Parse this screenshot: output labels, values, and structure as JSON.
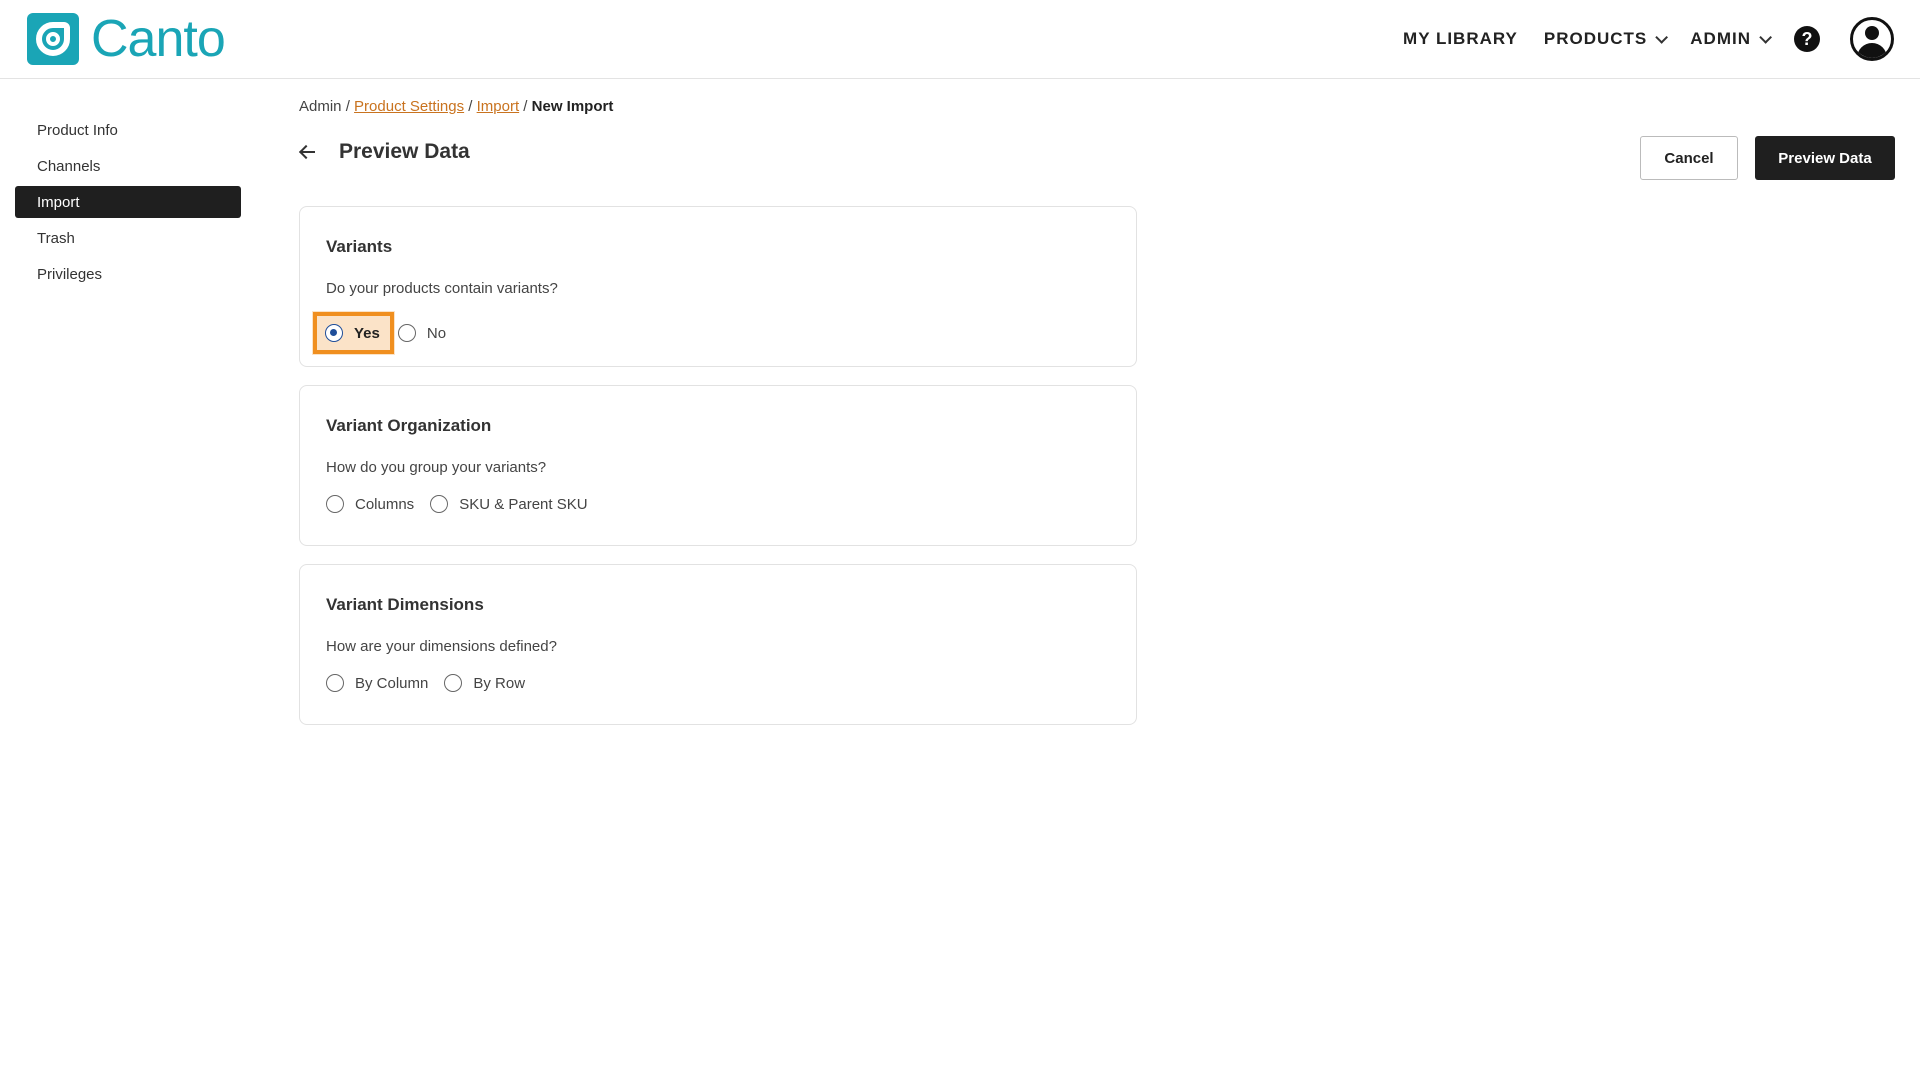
{
  "brand": {
    "name": "Canto",
    "color": "#1aa5b6"
  },
  "topnav": {
    "items": [
      {
        "label": "MY LIBRARY",
        "dropdown": false
      },
      {
        "label": "PRODUCTS",
        "dropdown": true
      },
      {
        "label": "ADMIN",
        "dropdown": true
      }
    ],
    "help_icon": "question-circle-icon",
    "help_glyph": "?",
    "avatar_icon": "user-avatar-icon"
  },
  "sidebar": {
    "items": [
      {
        "label": "Product Info",
        "active": false
      },
      {
        "label": "Channels",
        "active": false
      },
      {
        "label": "Import",
        "active": true
      },
      {
        "label": "Trash",
        "active": false
      },
      {
        "label": "Privileges",
        "active": false
      }
    ]
  },
  "breadcrumb": {
    "root": "Admin",
    "separator": " / ",
    "links": [
      "Product Settings",
      "Import"
    ],
    "current": "New Import"
  },
  "page": {
    "title": "Preview Data",
    "back_icon": "arrow-left-icon",
    "cancel_label": "Cancel",
    "preview_label": "Preview Data"
  },
  "cards": [
    {
      "title": "Variants",
      "question": "Do your products contain variants?",
      "options": [
        {
          "label": "Yes",
          "selected": true
        },
        {
          "label": "No",
          "selected": false
        }
      ]
    },
    {
      "title": "Variant Organization",
      "question": "How do you group your variants?",
      "options": [
        {
          "label": "Columns",
          "selected": false
        },
        {
          "label": "SKU & Parent SKU",
          "selected": false
        }
      ]
    },
    {
      "title": "Variant Dimensions",
      "question": "How are your dimensions defined?",
      "options": [
        {
          "label": "By Column",
          "selected": false
        },
        {
          "label": "By Row",
          "selected": false
        }
      ]
    }
  ],
  "colors": {
    "accent": "#1aa5b6",
    "link": "#c9731f",
    "active_bg": "#1f1f1f",
    "radio_selected": "#1f4e9a",
    "highlight": "#f08f1f"
  }
}
